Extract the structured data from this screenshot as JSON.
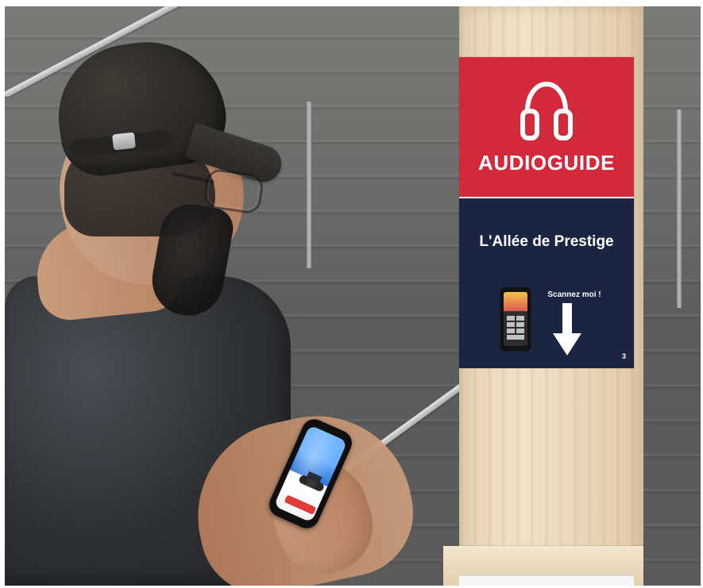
{
  "sign": {
    "title": "AUDIOGUIDE",
    "subtitle": "L'Allée de Prestige",
    "scan_text": "Scannez moi !",
    "page_number": "3",
    "icons": {
      "headphones": "headphones-icon",
      "arrow": "arrow-down-icon"
    },
    "colors": {
      "top": "#d32a3b",
      "bottom": "#1b2542"
    }
  }
}
